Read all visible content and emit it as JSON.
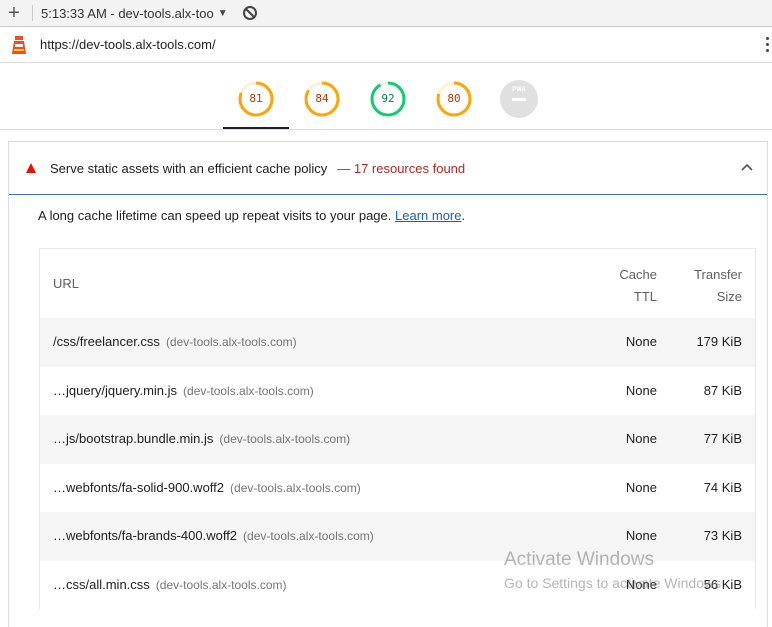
{
  "toolbar": {
    "report_label": "5:13:33 AM - dev-tools.alx-too"
  },
  "urlbar": {
    "url": "https://dev-tools.alx-tools.com/"
  },
  "gauges": [
    {
      "score": "81",
      "color": "#ffa400"
    },
    {
      "score": "84",
      "color": "#ffa400"
    },
    {
      "score": "92",
      "color": "#0cce6b"
    },
    {
      "score": "80",
      "color": "#ffa400"
    }
  ],
  "pwa": {
    "label": "PWA"
  },
  "audit": {
    "title": "Serve static assets with an efficient cache policy",
    "display_value": "— 17 resources found",
    "description": "A long cache lifetime can speed up repeat visits to your page.",
    "learn_more": "Learn more",
    "period": "."
  },
  "table": {
    "headers": {
      "url": "URL",
      "ttl_line1": "Cache",
      "ttl_line2": "TTL",
      "size_line1": "Transfer",
      "size_line2": "Size"
    },
    "rows": [
      {
        "url": "/css/freelancer.css",
        "host": "(dev-tools.alx-tools.com)",
        "ttl": "None",
        "size": "179 KiB"
      },
      {
        "url": "…jquery/jquery.min.js",
        "host": "(dev-tools.alx-tools.com)",
        "ttl": "None",
        "size": "87 KiB"
      },
      {
        "url": "…js/bootstrap.bundle.min.js",
        "host": "(dev-tools.alx-tools.com)",
        "ttl": "None",
        "size": "77 KiB"
      },
      {
        "url": "…webfonts/fa-solid-900.woff2",
        "host": "(dev-tools.alx-tools.com)",
        "ttl": "None",
        "size": "74 KiB"
      },
      {
        "url": "…webfonts/fa-brands-400.woff2",
        "host": "(dev-tools.alx-tools.com)",
        "ttl": "None",
        "size": "73 KiB"
      },
      {
        "url": "…css/all.min.css",
        "host": "(dev-tools.alx-tools.com)",
        "ttl": "None",
        "size": "56 KiB"
      }
    ]
  },
  "watermark": {
    "line1": "Activate Windows",
    "line2": "Go to Settings to activate Windows."
  },
  "colors": {
    "fail": "#eb0f00",
    "link": "#1a5fbf",
    "accent_border": "#3c6fd3"
  }
}
